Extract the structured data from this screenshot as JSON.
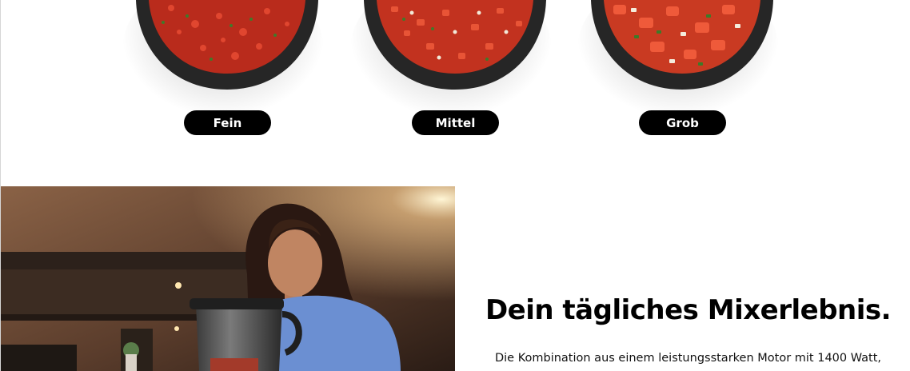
{
  "texture_options": [
    {
      "label": "Fein",
      "salsa": "fine"
    },
    {
      "label": "Mittel",
      "salsa": "medium"
    },
    {
      "label": "Grob",
      "salsa": "coarse"
    }
  ],
  "feature": {
    "heading": "Dein tägliches Mixerlebnis.",
    "body": "Die Kombination aus einem leistungsstarken Motor mit 1400 Watt,"
  },
  "colors": {
    "pill_bg": "#000000",
    "pill_text": "#ffffff",
    "bowl": "#2e2e2e",
    "salsa": "#c8301f"
  }
}
